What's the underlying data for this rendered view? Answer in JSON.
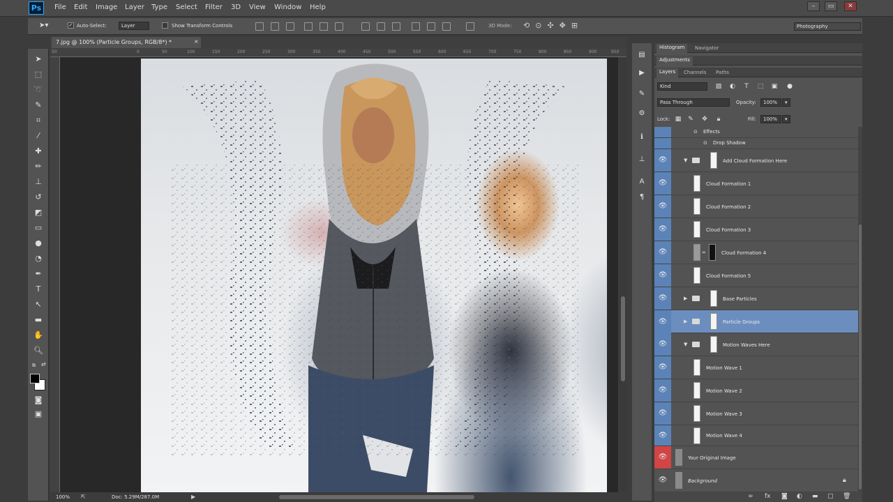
{
  "app": {
    "logo": "Ps"
  },
  "menu": [
    "File",
    "Edit",
    "Image",
    "Layer",
    "Type",
    "Select",
    "Filter",
    "3D",
    "View",
    "Window",
    "Help"
  ],
  "window_controls": {
    "minimize": "–",
    "maximize": "▭",
    "close": "✕"
  },
  "options_bar": {
    "auto_select": "Auto-Select:",
    "auto_select_target": "Layer",
    "show_transform": "Show Transform Controls",
    "mode_3d": "3D Mode:",
    "workspace": "Photography"
  },
  "document": {
    "tab_title": "7.jpg @ 100% (Particle Groups, RGB/8*) *",
    "zoom": "100%",
    "doc_info": "Doc: 5.29M/287.0M"
  },
  "ruler": {
    "top_ticks": [
      "50",
      "0",
      "50",
      "100",
      "150",
      "200",
      "250",
      "300",
      "350",
      "400",
      "450",
      "500",
      "550",
      "600",
      "650",
      "700",
      "750",
      "800",
      "850",
      "900",
      "950"
    ]
  },
  "tools": [
    "move-tool",
    "marquee-tool",
    "lasso-tool",
    "quick-select-tool",
    "crop-tool",
    "eyedropper-tool",
    "healing-tool",
    "brush-tool",
    "clone-stamp-tool",
    "history-brush-tool",
    "eraser-tool",
    "gradient-tool",
    "blur-tool",
    "dodge-tool",
    "pen-tool",
    "type-tool",
    "path-select-tool",
    "shape-tool",
    "hand-tool",
    "zoom-tool"
  ],
  "panels": {
    "top_tabs": [
      "Histogram",
      "Navigator"
    ],
    "adjustments_tab": "Adjustments",
    "layer_tabs": [
      "Layers",
      "Channels",
      "Paths"
    ],
    "kind_label": "Kind",
    "blend_mode": "Pass Through",
    "opacity_label": "Opacity:",
    "opacity_value": "100%",
    "lock_label": "Lock:",
    "fill_label": "Fill:",
    "fill_value": "100%"
  },
  "layers": [
    {
      "name": "Effects",
      "type": "effects",
      "indent": 1
    },
    {
      "name": "Drop Shadow",
      "type": "effect",
      "indent": 2
    },
    {
      "name": "Add Cloud Formation Here",
      "type": "group",
      "expanded": true,
      "visible": true
    },
    {
      "name": "Cloud Formation 1",
      "type": "layer",
      "visible": true
    },
    {
      "name": "Cloud Formation 2",
      "type": "layer",
      "visible": true
    },
    {
      "name": "Cloud Formation 3",
      "type": "layer",
      "visible": true
    },
    {
      "name": "Cloud Formation 4",
      "type": "layer-masked",
      "visible": true
    },
    {
      "name": "Cloud Formation 5",
      "type": "layer",
      "visible": true
    },
    {
      "name": "Base Particles",
      "type": "group",
      "expanded": false,
      "visible": true
    },
    {
      "name": "Particle Groups",
      "type": "group",
      "expanded": false,
      "visible": true,
      "selected": true
    },
    {
      "name": "Motion Waves Here",
      "type": "group",
      "expanded": true,
      "visible": true
    },
    {
      "name": "Motion Wave 1",
      "type": "layer",
      "visible": true
    },
    {
      "name": "Motion Wave 2",
      "type": "layer",
      "visible": true
    },
    {
      "name": "Motion Wave 3",
      "type": "layer",
      "visible": true
    },
    {
      "name": "Motion Wave 4",
      "type": "layer",
      "visible": true
    },
    {
      "name": "Your Original Image",
      "type": "layer",
      "visible": true,
      "color": "red"
    },
    {
      "name": "Background",
      "type": "background",
      "visible": true,
      "locked": true
    }
  ],
  "colors": {
    "eye_column": "#5b83b8",
    "red_label": "#d24545",
    "selected_row": "#6c8ebf",
    "panel_bg": "#535353"
  }
}
